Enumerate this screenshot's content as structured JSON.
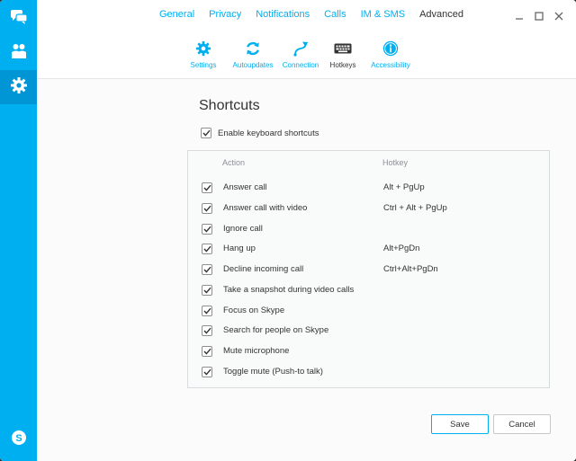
{
  "tabs": [
    {
      "label": "General",
      "active": false
    },
    {
      "label": "Privacy",
      "active": false
    },
    {
      "label": "Notifications",
      "active": false
    },
    {
      "label": "Calls",
      "active": false
    },
    {
      "label": "IM & SMS",
      "active": false
    },
    {
      "label": "Advanced",
      "active": true
    }
  ],
  "subtabs": [
    {
      "label": "Settings",
      "icon": "gear-icon",
      "active": false
    },
    {
      "label": "Autoupdates",
      "icon": "refresh-icon",
      "active": false
    },
    {
      "label": "Connection",
      "icon": "connection-icon",
      "active": false
    },
    {
      "label": "Hotkeys",
      "icon": "keyboard-icon",
      "active": true
    },
    {
      "label": "Accessibility",
      "icon": "accessibility-icon",
      "active": false
    }
  ],
  "page": {
    "title": "Shortcuts",
    "enable_label": "Enable keyboard shortcuts",
    "enable_checked": true
  },
  "table": {
    "col_action": "Action",
    "col_hotkey": "Hotkey",
    "rows": [
      {
        "action": "Answer call",
        "hotkey": "Alt + PgUp",
        "checked": true
      },
      {
        "action": "Answer call with video",
        "hotkey": "Ctrl + Alt + PgUp",
        "checked": true
      },
      {
        "action": "Ignore call",
        "hotkey": "",
        "checked": true
      },
      {
        "action": "Hang up",
        "hotkey": "Alt+PgDn",
        "checked": true
      },
      {
        "action": "Decline incoming call",
        "hotkey": "Ctrl+Alt+PgDn",
        "checked": true
      },
      {
        "action": "Take a snapshot during video calls",
        "hotkey": "",
        "checked": true
      },
      {
        "action": "Focus on Skype",
        "hotkey": "",
        "checked": true
      },
      {
        "action": "Search for people on Skype",
        "hotkey": "",
        "checked": true
      },
      {
        "action": "Mute microphone",
        "hotkey": "",
        "checked": true
      },
      {
        "action": "Toggle mute (Push-to talk)",
        "hotkey": "",
        "checked": true
      }
    ]
  },
  "buttons": {
    "save": "Save",
    "cancel": "Cancel"
  },
  "sidebar": [
    {
      "icon": "chat-icon",
      "active": false
    },
    {
      "icon": "contacts-icon",
      "active": false
    },
    {
      "icon": "gear-icon",
      "active": true
    },
    {
      "icon": "skype-logo-icon",
      "active": false
    }
  ],
  "colors": {
    "accent": "#00aff0",
    "sidebar_active": "#0096d6",
    "text": "#333333"
  }
}
